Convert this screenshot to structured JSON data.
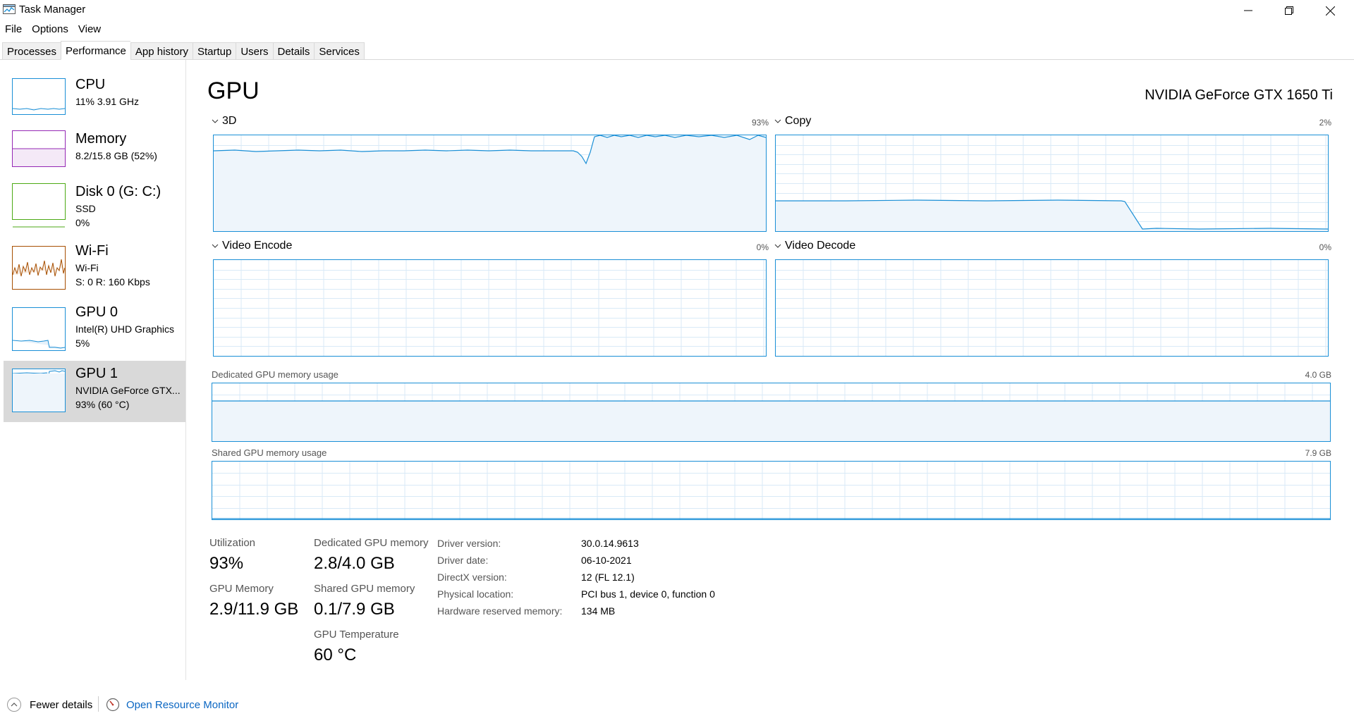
{
  "window": {
    "title": "Task Manager"
  },
  "menu": [
    "File",
    "Options",
    "View"
  ],
  "tabs": [
    {
      "label": "Processes",
      "active": false
    },
    {
      "label": "Performance",
      "active": true
    },
    {
      "label": "App history",
      "active": false
    },
    {
      "label": "Startup",
      "active": false
    },
    {
      "label": "Users",
      "active": false
    },
    {
      "label": "Details",
      "active": false
    },
    {
      "label": "Services",
      "active": false
    }
  ],
  "sidebar": {
    "items": [
      {
        "title": "CPU",
        "line1": "11%  3.91 GHz",
        "line2": "",
        "color": "#1a8fd6"
      },
      {
        "title": "Memory",
        "line1": "8.2/15.8 GB (52%)",
        "line2": "",
        "color": "#9528b4"
      },
      {
        "title": "Disk 0 (G: C:)",
        "line1": "SSD",
        "line2": "0%",
        "color": "#4caa14"
      },
      {
        "title": "Wi-Fi",
        "line1": "Wi-Fi",
        "line2": "S: 0  R: 160 Kbps",
        "color": "#a74f01"
      },
      {
        "title": "GPU 0",
        "line1": "Intel(R) UHD Graphics",
        "line2": "5%",
        "color": "#1a8fd6"
      },
      {
        "title": "GPU 1",
        "line1": "NVIDIA GeForce GTX...",
        "line2": "93%  (60 °C)",
        "color": "#1a8fd6",
        "selected": true
      }
    ]
  },
  "main": {
    "title": "GPU",
    "device_name": "NVIDIA GeForce GTX 1650 Ti",
    "graphs": {
      "3d": {
        "label": "3D",
        "max": "93%"
      },
      "copy": {
        "label": "Copy",
        "max": "2%"
      },
      "encode": {
        "label": "Video Encode",
        "max": "0%"
      },
      "decode": {
        "label": "Video Decode",
        "max": "0%"
      },
      "dedicated": {
        "label": "Dedicated GPU memory usage",
        "max": "4.0 GB"
      },
      "shared": {
        "label": "Shared GPU memory usage",
        "max": "7.9 GB"
      }
    },
    "stats": {
      "utilization": {
        "label": "Utilization",
        "value": "93%"
      },
      "dedicated_mem": {
        "label": "Dedicated GPU memory",
        "value": "2.8/4.0 GB"
      },
      "gpu_memory": {
        "label": "GPU Memory",
        "value": "2.9/11.9 GB"
      },
      "shared_mem": {
        "label": "Shared GPU memory",
        "value": "0.1/7.9 GB"
      },
      "temperature": {
        "label": "GPU Temperature",
        "value": "60 °C"
      }
    },
    "info": [
      {
        "key": "Driver version:",
        "value": "30.0.14.9613"
      },
      {
        "key": "Driver date:",
        "value": "06-10-2021"
      },
      {
        "key": "DirectX version:",
        "value": "12 (FL 12.1)"
      },
      {
        "key": "Physical location:",
        "value": "PCI bus 1, device 0, function 0"
      },
      {
        "key": "Hardware reserved memory:",
        "value": "134 MB"
      }
    ],
    "accent_color": "#1a8fd6"
  },
  "footer": {
    "fewer_details": "Fewer details",
    "open_resource_monitor": "Open Resource Monitor"
  }
}
